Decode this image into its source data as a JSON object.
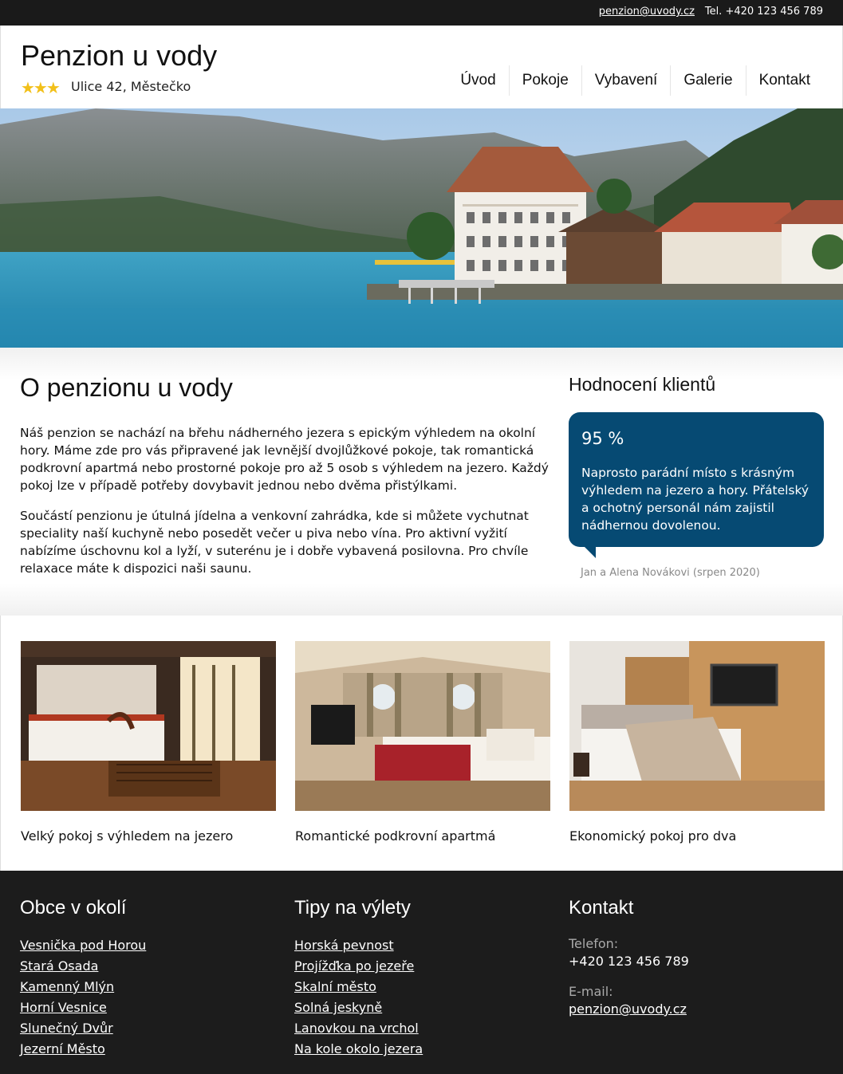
{
  "topbar": {
    "email": "penzion@uvody.cz",
    "phone": "Tel. +420 123 456 789"
  },
  "header": {
    "brand": "Penzion u vody",
    "stars": "★★★",
    "address": "Ulice 42, Městečko",
    "nav": [
      "Úvod",
      "Pokoje",
      "Vybavení",
      "Galerie",
      "Kontakt"
    ]
  },
  "about": {
    "title": "O penzionu u vody",
    "p1": "Náš penzion se nachází na břehu nádherného jezera s epickým výhledem na okolní hory. Máme zde pro vás připravené jak levnější dvojlůžkové pokoje, tak romantická podkrovní apartmá nebo prostorné pokoje pro až 5 osob s výhledem na jezero. Každý pokoj lze v případě potřeby dovybavit jednou nebo dvěma přistýlkami.",
    "p2": "Součástí penzionu je útulná jídelna a venkovní zahrádka, kde si můžete vychutnat speciality naší kuchyně nebo posedět večer u piva nebo vína. Pro aktivní vyžití nabízíme úschovnu kol a lyží, v suterénu je i dobře vybavená posilovna. Pro chvíle relaxace máte k dispozici naši saunu."
  },
  "rating": {
    "title": "Hodnocení klientů",
    "percent": "95 %",
    "quote": "Naprosto parádní místo s krásným výhledem na jezero a hory. Přátelský a ochotný personál nám zajistil nádhernou dovolenou.",
    "author": "Jan a Alena Novákovi (srpen 2020)"
  },
  "rooms": [
    {
      "caption": "Velký pokoj s výhledem na jezero"
    },
    {
      "caption": "Romantické podkrovní apartmá"
    },
    {
      "caption": "Ekonomický pokoj pro dva"
    }
  ],
  "footer": {
    "villages_title": "Obce v okolí",
    "villages": [
      "Vesnička pod Horou",
      "Stará Osada",
      "Kamenný Mlýn",
      "Horní Vesnice",
      "Slunečný Dvůr",
      "Jezerní Město"
    ],
    "trips_title": "Tipy na výlety",
    "trips": [
      "Horská pevnost",
      "Projížďka po jezeře",
      "Skalní město",
      "Solná jeskyně",
      "Lanovkou na vrchol",
      "Na kole okolo jezera"
    ],
    "contact_title": "Kontakt",
    "phone_label": "Telefon:",
    "phone": "+420 123 456 789",
    "email_label": "E-mail:",
    "email": "penzion@uvody.cz"
  },
  "colors": {
    "accent": "#064a73",
    "stars": "#f2c01a",
    "dark": "#1c1c1c"
  }
}
